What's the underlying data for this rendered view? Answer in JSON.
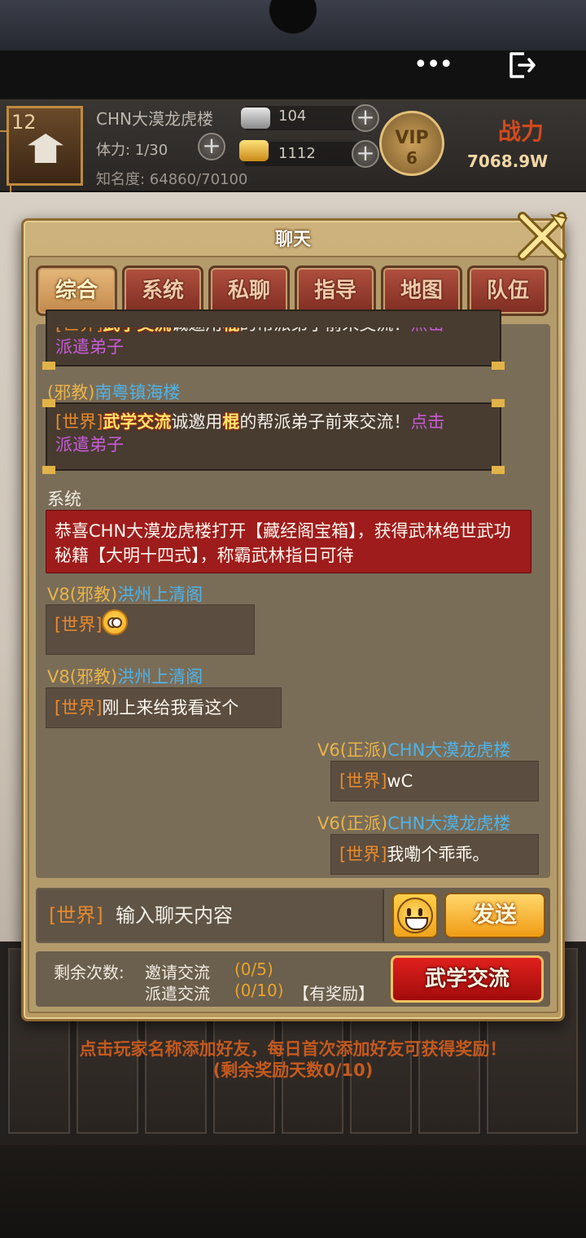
{
  "top_bar": {
    "menu_icon": "more-dots-icon",
    "exit_icon": "exit-icon"
  },
  "player": {
    "level": "12",
    "name": "CHN大漠龙虎楼",
    "stamina": "体力: 1/30",
    "fame": "知名度: 64860/70100",
    "silver": "104",
    "gold": "1112",
    "vip_label": "VIP",
    "vip_level": "6",
    "power_label": "战力",
    "power_value": "7068.9W"
  },
  "dialog": {
    "title": "聊天",
    "tabs": [
      "综合",
      "系统",
      "私聊",
      "指导",
      "地图",
      "队伍"
    ],
    "active_tab": "综合"
  },
  "messages": {
    "m1_world": "[世界]",
    "m1_badge": "武学交流",
    "m1_text": "诚邀用",
    "m1_item": "棍",
    "m1_text2": "的帮派弟子前来交流！",
    "m1_link": "点击",
    "m1_link2": "派遣弟子",
    "m2_faction": "(邪教)",
    "m2_name": "南粤镇海楼",
    "m2_world": "[世界]",
    "m2_badge": "武学交流",
    "m2_text": "诚邀用",
    "m2_item": "棍",
    "m2_text2": "的帮派弟子前来交流！",
    "m2_link": "点击",
    "m2_link2": "派遣弟子",
    "sys_label": "系统",
    "sys_text": "恭喜CHN大漠龙虎楼打开【藏经阁宝箱】，获得武林绝世武功秘籍【大明十四式】，称霸武林指日可待",
    "m3_vip": "V8",
    "m3_faction": "(邪教)",
    "m3_name": "洪州上清阁",
    "m3_world": "[世界]",
    "m4_vip": "V8",
    "m4_faction": "(邪教)",
    "m4_name": "洪州上清阁",
    "m4_world": "[世界]",
    "m4_text": "刚上来给我看这个",
    "m5_vip": "V6",
    "m5_faction": "(正派)",
    "m5_name": "CHN大漠龙虎楼",
    "m5_world": "[世界]",
    "m5_text": "wC",
    "m6_vip": "V6",
    "m6_faction": "(正派)",
    "m6_name": "CHN大漠龙虎楼",
    "m6_world": "[世界]",
    "m6_text": "我嘞个乖乖。"
  },
  "input": {
    "channel": "[世界]",
    "placeholder": "输入聊天内容",
    "send_label": "发送"
  },
  "stats": {
    "remaining_label": "剩余次数:",
    "invite_label": "邀请交流",
    "invite_count": "(0/5)",
    "dispatch_label": "派遣交流",
    "dispatch_count": "(0/10)",
    "reward_label": "【有奖励】",
    "wx_button": "武学交流"
  },
  "hints": {
    "line1": "点击玩家名称添加好友，每日首次添加好友可获得奖励！",
    "line2": "(剩余奖励天数0/10)"
  },
  "colors": {
    "world_tag": "#e88a2d",
    "player_name": "#4fb3e8",
    "faction": "#e8b44a",
    "system_box": "#9e1c1b",
    "link_purple": "#c75bd8"
  }
}
